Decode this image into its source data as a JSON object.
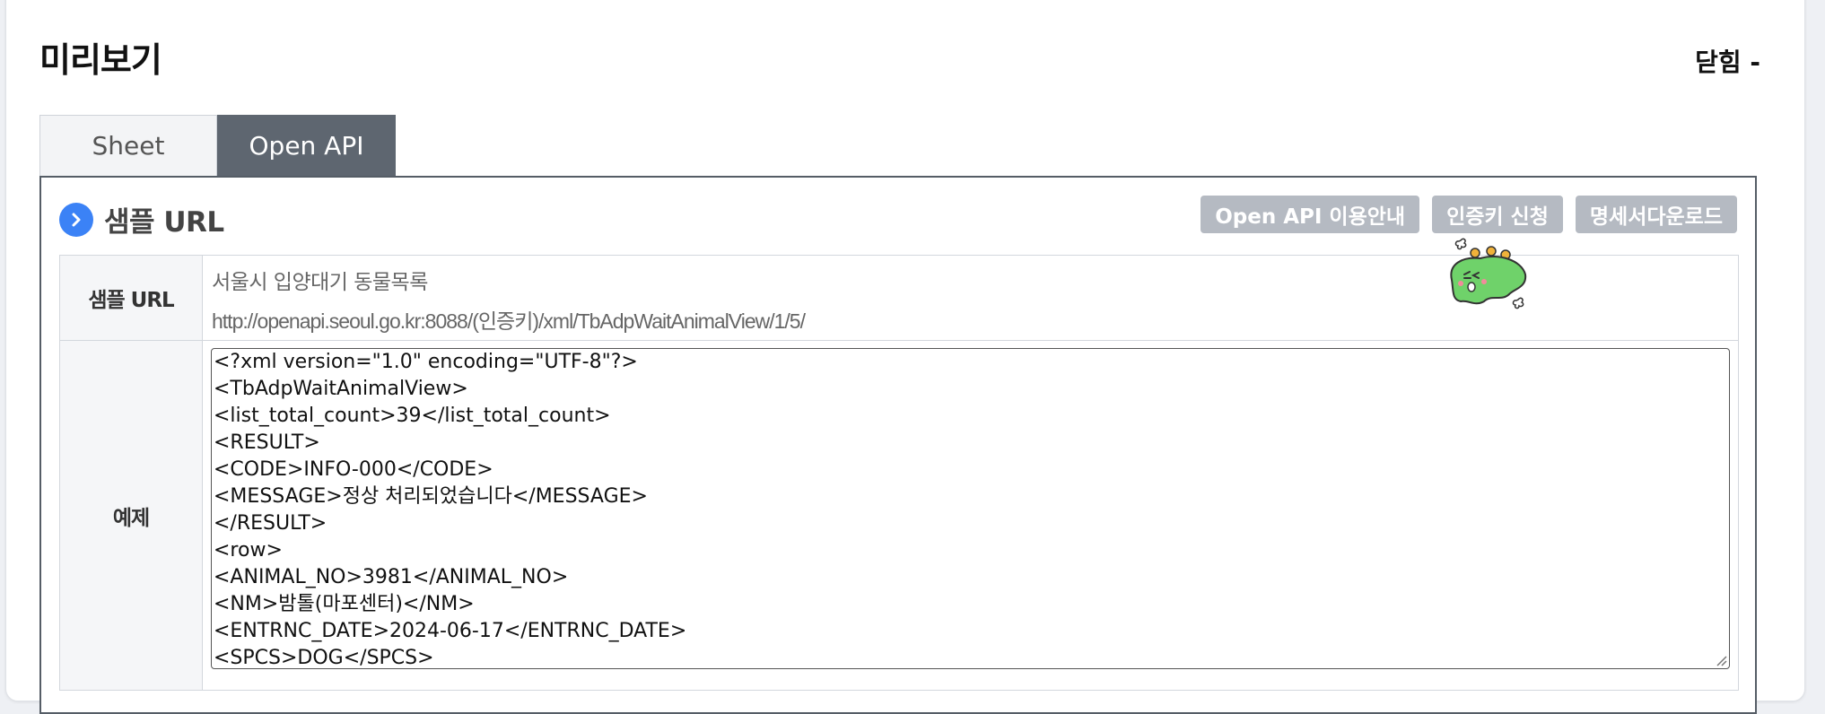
{
  "header": {
    "title": "미리보기",
    "close_label": "닫힘 -"
  },
  "tabs": [
    {
      "label": "Sheet",
      "active": false
    },
    {
      "label": "Open API",
      "active": true
    }
  ],
  "section": {
    "title": "샘플 URL",
    "icon": "chevron-right-circle-icon"
  },
  "buttons": {
    "guide": "Open API 이용안내",
    "apply_key": "인증키 신청",
    "download_spec": "명세서다운로드"
  },
  "table": {
    "url_label": "샘플 URL",
    "dataset_name": "서울시 입양대기 동물목록",
    "sample_url": "http://openapi.seoul.go.kr:8088/(인증키)/xml/TbAdpWaitAnimalView/1/5/",
    "example_label": "예제"
  },
  "example_code": [
    "<?xml version=\"1.0\" encoding=\"UTF-8\"?>",
    "<TbAdpWaitAnimalView>",
    "<list_total_count>39</list_total_count>",
    "<RESULT>",
    "<CODE>INFO-000</CODE>",
    "<MESSAGE>정상 처리되었습니다</MESSAGE>",
    "</RESULT>",
    "<row>",
    "<ANIMAL_NO>3981</ANIMAL_NO>",
    "<NM>밤톨(마포센터)</NM>",
    "<ENTRNC_DATE>2024-06-17</ENTRNC_DATE>",
    "<SPCS>DOG</SPCS>"
  ],
  "colors": {
    "accent": "#3b82f6",
    "tab_active_bg": "#5e6670",
    "button_bg": "#b5bac2",
    "mascot": "#6fd26a"
  }
}
